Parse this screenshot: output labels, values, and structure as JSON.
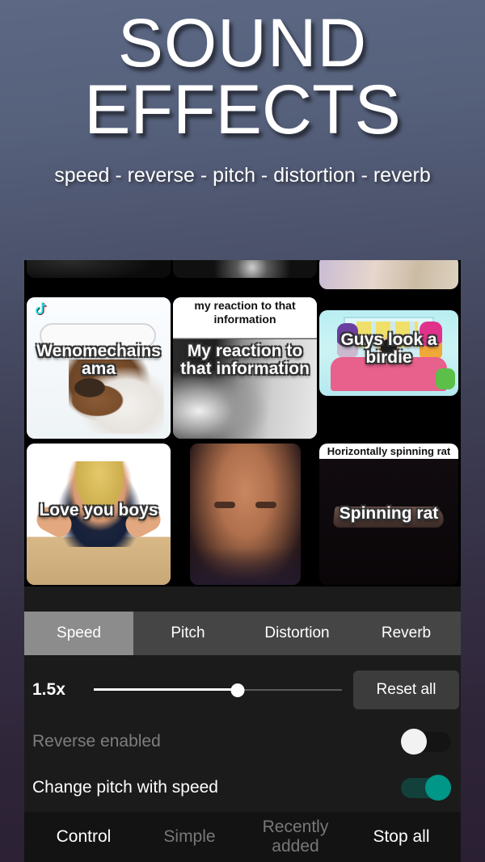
{
  "header": {
    "title_line1": "SOUND",
    "title_line2": "EFFECTS",
    "subtitle": "speed - reverse - pitch - distortion - reverb"
  },
  "grid": {
    "tiles": [
      {
        "caption": "Wenomechains ama",
        "overlay_label": "",
        "icon": "tiktok-icon"
      },
      {
        "caption": "My reaction to that information",
        "overlay_label": "my reaction to that information",
        "icon": ""
      },
      {
        "caption": "Guys look a birdie",
        "overlay_label": "",
        "icon": ""
      },
      {
        "caption": "Love you boys",
        "overlay_label": "",
        "icon": ""
      },
      {
        "caption": "",
        "overlay_label": "",
        "icon": ""
      },
      {
        "caption": "Spinning rat",
        "overlay_label": "Horizontally spinning rat",
        "icon": ""
      }
    ]
  },
  "tabs": [
    {
      "label": "Speed",
      "active": true
    },
    {
      "label": "Pitch",
      "active": false
    },
    {
      "label": "Distortion",
      "active": false
    },
    {
      "label": "Reverb",
      "active": false
    }
  ],
  "speed": {
    "value_label": "1.5x",
    "slider_percent": 58,
    "reset_label": "Reset all"
  },
  "toggles": [
    {
      "label": "Reverse enabled",
      "on": false
    },
    {
      "label": "Change pitch with speed",
      "on": true
    }
  ],
  "bottom_nav": [
    {
      "label": "Control",
      "active": true
    },
    {
      "label": "Simple",
      "active": false
    },
    {
      "label": "Recently added",
      "active": false
    },
    {
      "label": "Stop all",
      "active": true
    }
  ],
  "colors": {
    "accent_teal": "#009688",
    "tab_active": "#8c8c8c",
    "tab_bar": "#454545",
    "panel_bg": "#1b1b1b",
    "nav_bg": "#131313",
    "bg_top": "#5c6884",
    "bg_bottom": "#2a1f33"
  }
}
